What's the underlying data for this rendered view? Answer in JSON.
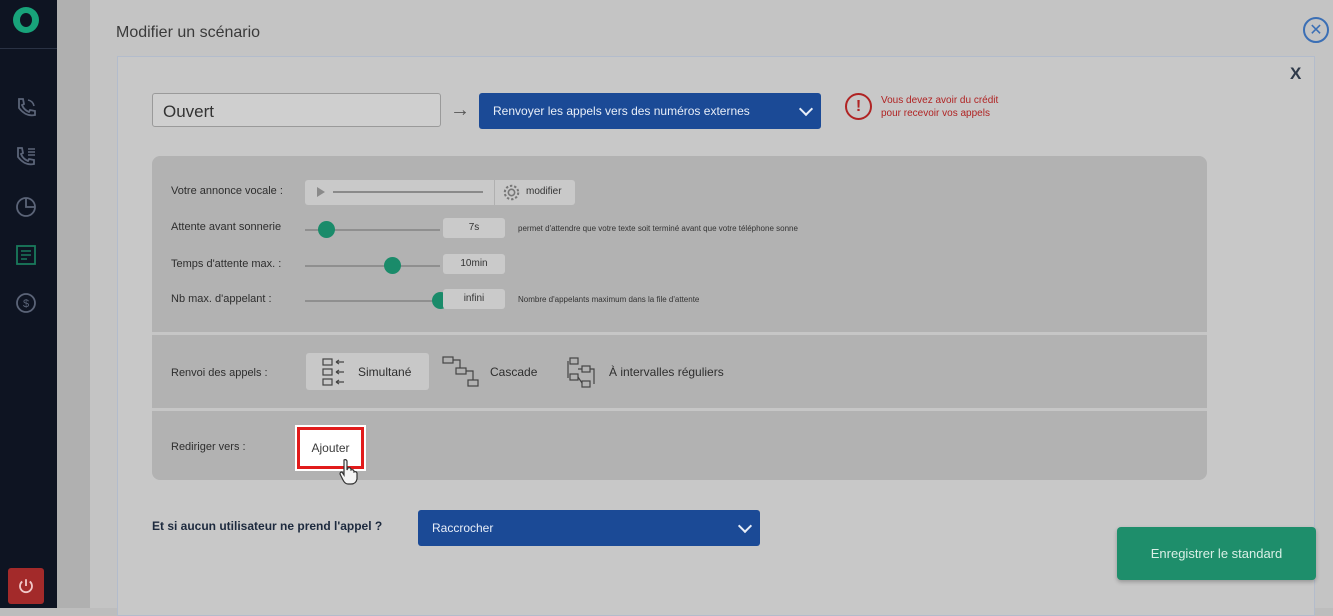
{
  "sidebar": {
    "icons": [
      "logo-icon",
      "phone-icon",
      "phone-list-icon",
      "pie-chart-icon",
      "scenario-icon",
      "dollar-icon",
      "power-icon"
    ]
  },
  "dialog": {
    "title": "Modifier un scénario",
    "close_icon": "close-circle-icon",
    "card_close_label": "X"
  },
  "scenario": {
    "name": "Ouvert",
    "action_select": "Renvoyer les appels vers des numéros externes",
    "warning_line1": "Vous devez avoir du crédit",
    "warning_line2": "pour recevoir vos appels"
  },
  "settings": {
    "voice_label": "Votre annonce vocale :",
    "voice_modify": "modifier",
    "wait_label": "Attente avant sonnerie",
    "wait_value": "7s",
    "wait_level": 0.16,
    "wait_hint": "permet d'attendre que votre texte soit terminé avant que votre téléphone sonne",
    "max_wait_label": "Temps d'attente max. :",
    "max_wait_value": "10min",
    "max_wait_level": 0.65,
    "max_callers_label": "Nb max. d'appelant :",
    "max_callers_value": "infini",
    "max_callers_level": 1.0,
    "max_callers_hint": "Nombre d'appelants maximum dans la file d'attente"
  },
  "routing": {
    "label": "Renvoi des appels :",
    "modes": [
      "Simultané",
      "Cascade",
      "À intervalles réguliers"
    ],
    "active_mode": "Simultané"
  },
  "redirect": {
    "label": "Rediriger vers :",
    "add_button": "Ajouter"
  },
  "no_answer": {
    "question": "Et si aucun utilisateur ne prend l'appel ?",
    "select": "Raccrocher"
  },
  "footer": {
    "save_button": "Enregistrer le standard"
  },
  "colors": {
    "accent_blue": "#1b4a96",
    "accent_green": "#1e8e6b",
    "warning_red": "#b02323",
    "highlight_red": "#e11b1b"
  }
}
